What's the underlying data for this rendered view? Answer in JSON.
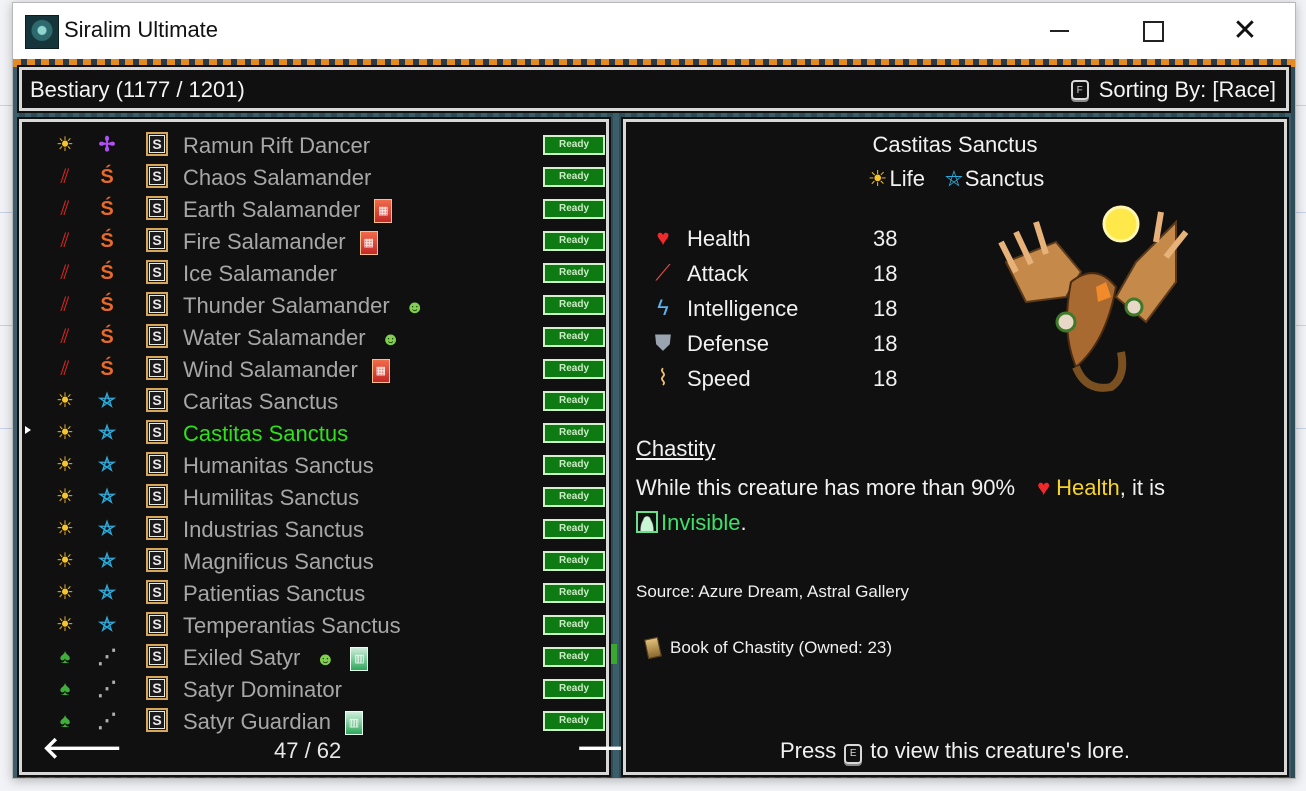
{
  "window": {
    "title": "Siralim Ultimate"
  },
  "header": {
    "bestiary_label": "Bestiary (1177 / 1201)",
    "sort_key": "F",
    "sort_label": "Sorting By: [Race]"
  },
  "list": {
    "rows": [
      {
        "name": "Ramun Rift Dancer",
        "class": "life",
        "race_icon": "rift-dancer-icon",
        "extra": "",
        "status": "Ready"
      },
      {
        "name": "Chaos Salamander",
        "class": "chaos",
        "race_icon": "salamander-icon",
        "extra": "",
        "status": "Ready"
      },
      {
        "name": "Earth Salamander",
        "class": "chaos",
        "race_icon": "salamander-icon",
        "extra": "card",
        "status": "Ready"
      },
      {
        "name": "Fire Salamander",
        "class": "chaos",
        "race_icon": "salamander-icon",
        "extra": "card",
        "status": "Ready"
      },
      {
        "name": "Ice Salamander",
        "class": "chaos",
        "race_icon": "salamander-icon",
        "extra": "",
        "status": "Ready"
      },
      {
        "name": "Thunder Salamander",
        "class": "chaos",
        "race_icon": "salamander-icon",
        "extra": "goblin",
        "status": "Ready"
      },
      {
        "name": "Water Salamander",
        "class": "chaos",
        "race_icon": "salamander-icon",
        "extra": "goblin",
        "status": "Ready"
      },
      {
        "name": "Wind Salamander",
        "class": "chaos",
        "race_icon": "salamander-icon",
        "extra": "card",
        "status": "Ready"
      },
      {
        "name": "Caritas Sanctus",
        "class": "life",
        "race_icon": "sanctus-icon",
        "extra": "",
        "status": "Ready"
      },
      {
        "name": "Castitas Sanctus",
        "class": "life",
        "race_icon": "sanctus-icon",
        "extra": "",
        "status": "Ready",
        "selected": true
      },
      {
        "name": "Humanitas Sanctus",
        "class": "life",
        "race_icon": "sanctus-icon",
        "extra": "",
        "status": "Ready"
      },
      {
        "name": "Humilitas Sanctus",
        "class": "life",
        "race_icon": "sanctus-icon",
        "extra": "",
        "status": "Ready"
      },
      {
        "name": "Industrias Sanctus",
        "class": "life",
        "race_icon": "sanctus-icon",
        "extra": "",
        "status": "Ready"
      },
      {
        "name": "Magnificus Sanctus",
        "class": "life",
        "race_icon": "sanctus-icon",
        "extra": "",
        "status": "Ready"
      },
      {
        "name": "Patientias Sanctus",
        "class": "life",
        "race_icon": "sanctus-icon",
        "extra": "",
        "status": "Ready"
      },
      {
        "name": "Temperantias Sanctus",
        "class": "life",
        "race_icon": "sanctus-icon",
        "extra": "",
        "status": "Ready"
      },
      {
        "name": "Exiled Satyr",
        "class": "nature",
        "race_icon": "satyr-icon",
        "extra": "goblin+gcard",
        "status": "Ready"
      },
      {
        "name": "Satyr Dominator",
        "class": "nature",
        "race_icon": "satyr-icon",
        "extra": "",
        "status": "Ready"
      },
      {
        "name": "Satyr Guardian",
        "class": "nature",
        "race_icon": "satyr-icon",
        "extra": "gcard",
        "status": "Ready"
      }
    ],
    "page": "47 / 62",
    "class_colors": {
      "life": "#f7c52b",
      "chaos": "#d8261e",
      "nature": "#3fae3a"
    }
  },
  "detail": {
    "name": "Castitas Sanctus",
    "class_label": "Life",
    "race_label": "Sanctus",
    "stats": [
      {
        "icon": "heart-icon",
        "label": "Health",
        "value": "38"
      },
      {
        "icon": "sword-icon",
        "label": "Attack",
        "value": "18"
      },
      {
        "icon": "lightning-icon",
        "label": "Intelligence",
        "value": "18"
      },
      {
        "icon": "shield-icon",
        "label": "Defense",
        "value": "18"
      },
      {
        "icon": "wing-icon",
        "label": "Speed",
        "value": "18"
      }
    ],
    "trait": {
      "title": "Chastity",
      "desc_pre": "While this creature has more than 90%",
      "kw_health": "Health",
      "desc_mid": ", it is",
      "kw_invisible": "Invisible",
      "desc_end": "."
    },
    "source": "Source: Azure Dream, Astral Gallery",
    "book": "Book of Chastity (Owned: 23)",
    "press_pre": "Press",
    "press_key": "E",
    "press_post": "to view this creature's lore."
  },
  "colors": {
    "selected": "#2fe01a",
    "ready_bg": "#0e7a12",
    "health_kw": "#f7d324",
    "invisible_kw": "#3de06a"
  }
}
